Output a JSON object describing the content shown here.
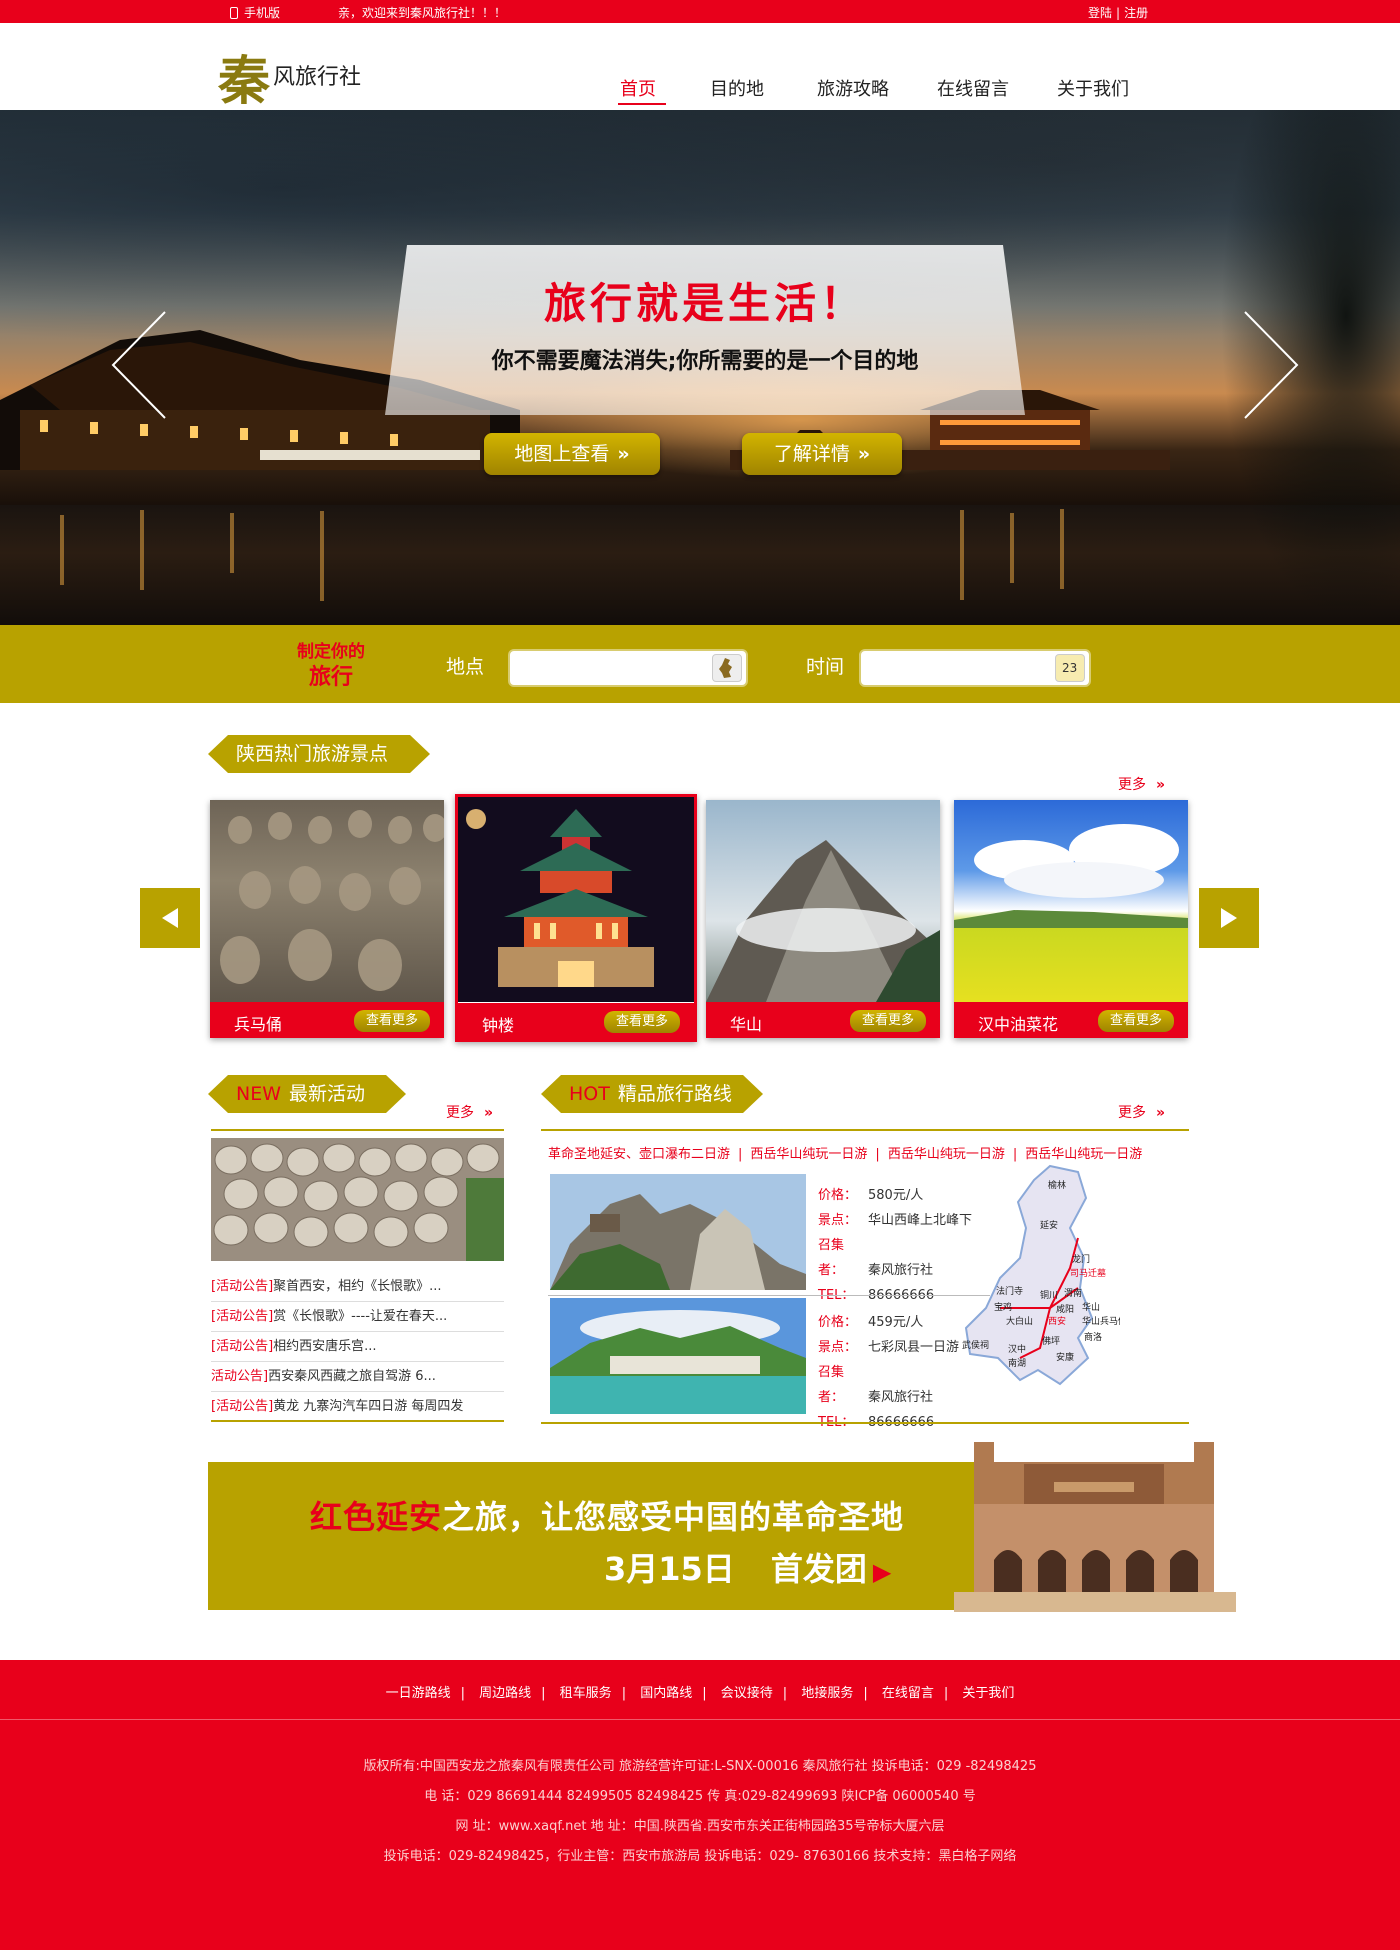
{
  "topbar": {
    "mobile": "手机版",
    "welcome": "亲，欢迎来到秦风旅行社！！！",
    "login": "登陆",
    "register": "注册",
    "sep": "|"
  },
  "logo": {
    "big": "秦",
    "rest": "风旅行社"
  },
  "nav": {
    "items": [
      "首页",
      "目的地",
      "旅游攻略",
      "在线留言",
      "关于我们"
    ],
    "active": 0
  },
  "hero": {
    "slogan": "旅行就是生活！",
    "sub": "你不需要魔法消失;你所需要的是一个目的地",
    "btn1": "地图上查看",
    "btn2": "了解详情",
    "chev": "»"
  },
  "plan": {
    "line1": "制定你的",
    "line2": "旅行",
    "place_label": "地点",
    "time_label": "时间",
    "place_value": "",
    "time_value": "",
    "calendar_day": "23"
  },
  "hot_spots": {
    "title": "陕西热门旅游景点",
    "more": "更多",
    "view_more": "查看更多",
    "items": [
      "兵马俑",
      "钟楼",
      "华山",
      "汉中油菜花"
    ]
  },
  "activities": {
    "new": "NEW",
    "title": "最新活动",
    "more": "更多",
    "rows": [
      {
        "tag": "[活动公告]",
        "text": "聚首西安，相约《长恨歌》..."
      },
      {
        "tag": "[活动公告]",
        "text": "赏《长恨歌》----让爱在春天..."
      },
      {
        "tag": "[活动公告]",
        "text": "相约西安唐乐宫..."
      },
      {
        "tag": "活动公告]",
        "text": "西安秦风西藏之旅自驾游 6..."
      },
      {
        "tag": "[活动公告]",
        "text": "黄龙 九寨沟汽车四日游 每周四发"
      }
    ]
  },
  "routes": {
    "hot": "HOT",
    "title": "精品旅行路线",
    "more": "更多",
    "links": [
      "革命圣地延安、壶口瀑布二日游",
      "西岳华山纯玩一日游",
      "西岳华山纯玩一日游",
      "西岳华山纯玩一日游"
    ],
    "labels": {
      "price": "价格：",
      "spot": "景点：",
      "org": "召集者：",
      "tel": "TEL："
    },
    "items": [
      {
        "price": "580元/人",
        "spot": "华山西峰上北峰下",
        "org": "秦风旅行社",
        "tel": "86666666"
      },
      {
        "price": "459元/人",
        "spot": "七彩凤县一日游",
        "org": "秦风旅行社",
        "tel": "86666666"
      }
    ],
    "map_labels": [
      "榆林",
      "延安",
      "龙门",
      "司马迁墓",
      "法门寺",
      "铜川",
      "渭南",
      "宝鸡",
      "大白山",
      "咸阳",
      "西安",
      "华山",
      "华山兵马俑",
      "商洛",
      "武侯祠",
      "汉中",
      "佛坪",
      "安康",
      "南湖"
    ]
  },
  "banner": {
    "red": "红色延安",
    "rest": "之旅，让您感受中国的革命圣地",
    "date": "3月15日",
    "group": "首发团",
    "tri": "▶"
  },
  "footer": {
    "links": [
      "一日游路线",
      "周边路线",
      "租车服务",
      "国内路线",
      "会议接待",
      "地接服务",
      "在线留言",
      "关于我们"
    ],
    "sep": "|",
    "info": [
      "版权所有:中国西安龙之旅秦风有限责任公司 旅游经营许可证:L-SNX-00016 秦风旅行社 投诉电话：029 -82498425",
      "电 话：029 86691444 82499505 82498425 传 真:029-82499693 陕ICP备 06000540 号",
      "网 址：www.xaqf.net 地 址：中国.陕西省.西安市东关正街柿园路35号帝标大厦六层",
      "投诉电话：029-82498425，行业主管：西安市旅游局 投诉电话：029- 87630166 技术支持：黑白格子网络"
    ]
  },
  "colors": {
    "red": "#e8001b",
    "olive": "#b8a200"
  }
}
